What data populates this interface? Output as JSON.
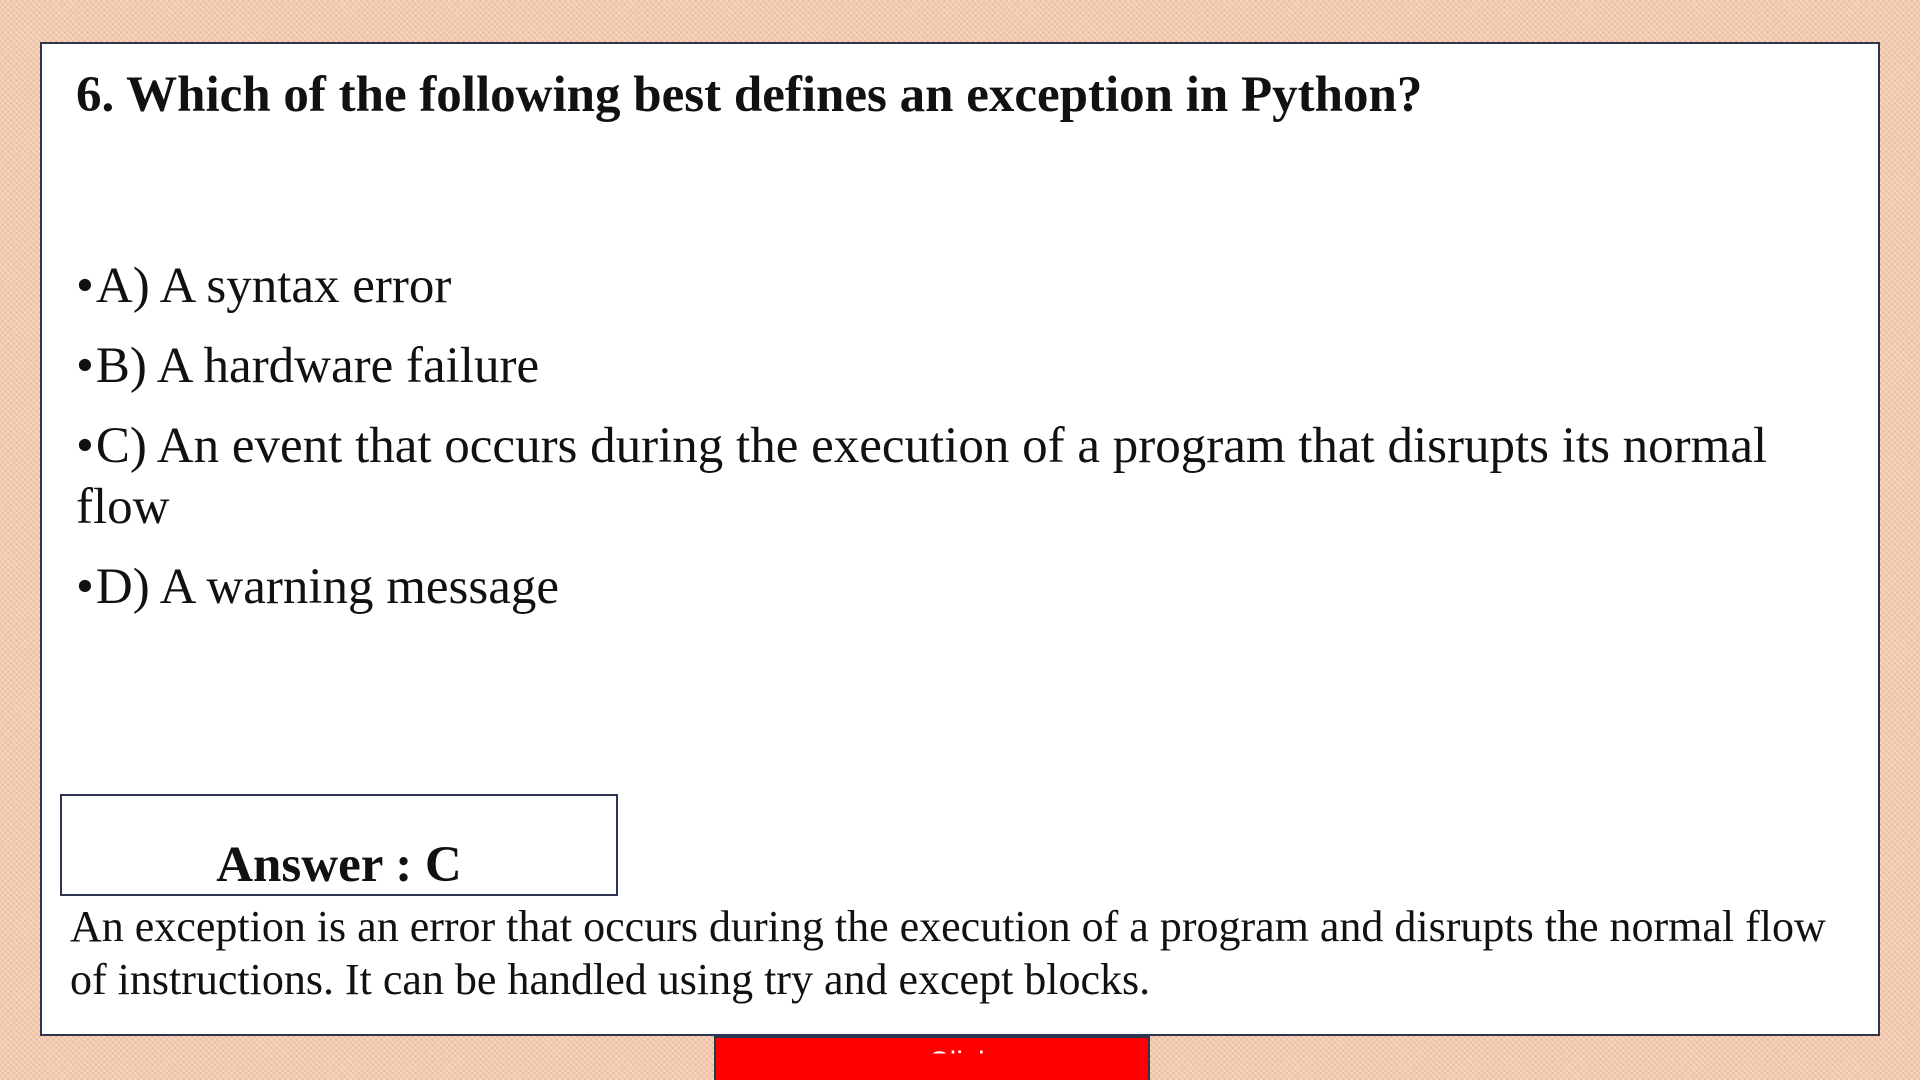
{
  "question": {
    "title": "6. Which of the following best defines an exception in Python?"
  },
  "options": [
    {
      "bullet": "•",
      "text": "A) A syntax error"
    },
    {
      "bullet": "•",
      "text": "B) A hardware failure"
    },
    {
      "bullet": "•",
      "text": "C) An event that occurs during the execution of a program that disrupts its normal flow"
    },
    {
      "bullet": "•",
      "text": "D) A warning message"
    }
  ],
  "answer": {
    "label": "Answer : C"
  },
  "explanation": {
    "text": "An exception is an error that occurs during the execution of a program and disrupts the normal flow of instructions. It can be handled using try and except blocks."
  },
  "banner": {
    "text": "Click",
    "color": "#ff0000"
  },
  "colors": {
    "background": "#f4c9ad",
    "card": "#ffffff",
    "border": "#2d3550"
  }
}
